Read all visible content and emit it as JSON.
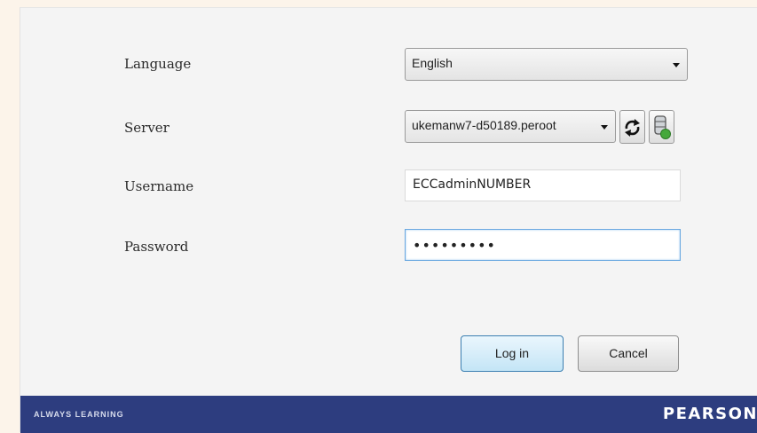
{
  "form": {
    "language_label": "Language",
    "language_value": "English",
    "server_label": "Server",
    "server_value": "ukemanw7-d50189.peroot",
    "username_label": "Username",
    "username_value": "ECCadminNUMBER",
    "password_label": "Password",
    "password_value": "•••••••••"
  },
  "buttons": {
    "login": "Log in",
    "cancel": "Cancel"
  },
  "footer": {
    "tagline": "ALWAYS LEARNING",
    "brand": "PEARSON"
  },
  "icons": {
    "refresh": "refresh-icon",
    "database": "database-add-icon"
  },
  "colors": {
    "footer_bg": "#2d3d7f",
    "primary_border": "#3c7fb1"
  }
}
